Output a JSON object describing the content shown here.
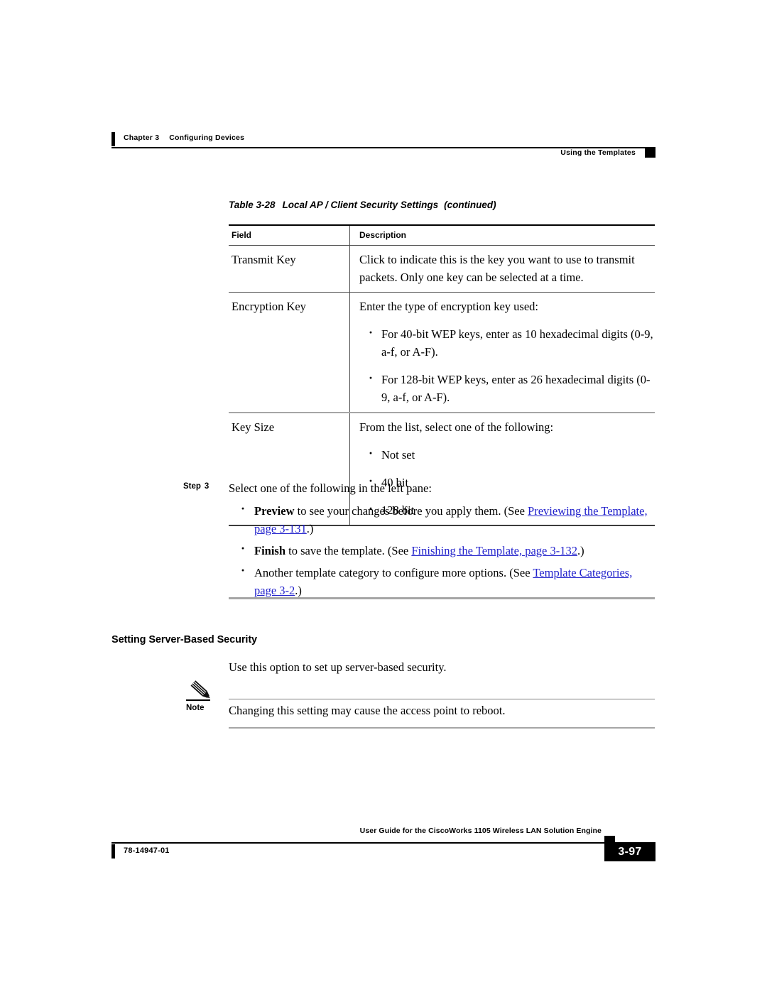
{
  "header": {
    "chapter": "Chapter 3",
    "chapter_title": "Configuring Devices",
    "section": "Using the Templates"
  },
  "table": {
    "label": "Table 3-28",
    "title": "Local AP / Client Security Settings",
    "continued": "(continued)",
    "columns": [
      "Field",
      "Description"
    ],
    "rows": [
      {
        "field": "Transmit Key",
        "description": "Click to indicate this is the key you want to use to transmit packets. Only one key can be selected at a time.",
        "bullets": []
      },
      {
        "field": "Encryption Key",
        "description": "Enter the type of encryption key used:",
        "bullets": [
          "For 40-bit WEP keys, enter as 10 hexadecimal digits (0-9, a-f, or A-F).",
          "For 128-bit WEP keys, enter as 26 hexadecimal digits (0-9, a-f, or A-F)."
        ]
      },
      {
        "field": "Key Size",
        "description": "From the list, select one of the following:",
        "bullets": [
          "Not set",
          "40 bit",
          "128 bit"
        ]
      }
    ]
  },
  "step": {
    "label": "Step",
    "number": "3",
    "text": "Select one of the following in the left pane:",
    "bullets": [
      {
        "bold": "Preview",
        "text": " to see your changes before you apply them. (See ",
        "link": "Previewing the Template, page 3-131",
        "tail": ".)"
      },
      {
        "bold": "Finish",
        "text": " to save the template. (See ",
        "link": "Finishing the Template, page 3-132",
        "tail": ".)"
      },
      {
        "bold": "",
        "text": "Another template category to configure more options. (See ",
        "link": "Template Categories, page 3-2",
        "tail": ".)"
      }
    ]
  },
  "section": {
    "heading": "Setting Server-Based Security",
    "paragraph": "Use this option to set up server-based security."
  },
  "note": {
    "icon": "pencil-icon",
    "label": "Note",
    "text": "Changing this setting may cause the access point to reboot."
  },
  "footer": {
    "guide_title": "User Guide for the CiscoWorks 1105 Wireless LAN Solution Engine",
    "doc_number": "78-14947-01",
    "page_number": "3-97"
  },
  "colors": {
    "link": "#2222cc",
    "rule_dark": "#000000",
    "rule_gray": "#a6a6a6"
  }
}
